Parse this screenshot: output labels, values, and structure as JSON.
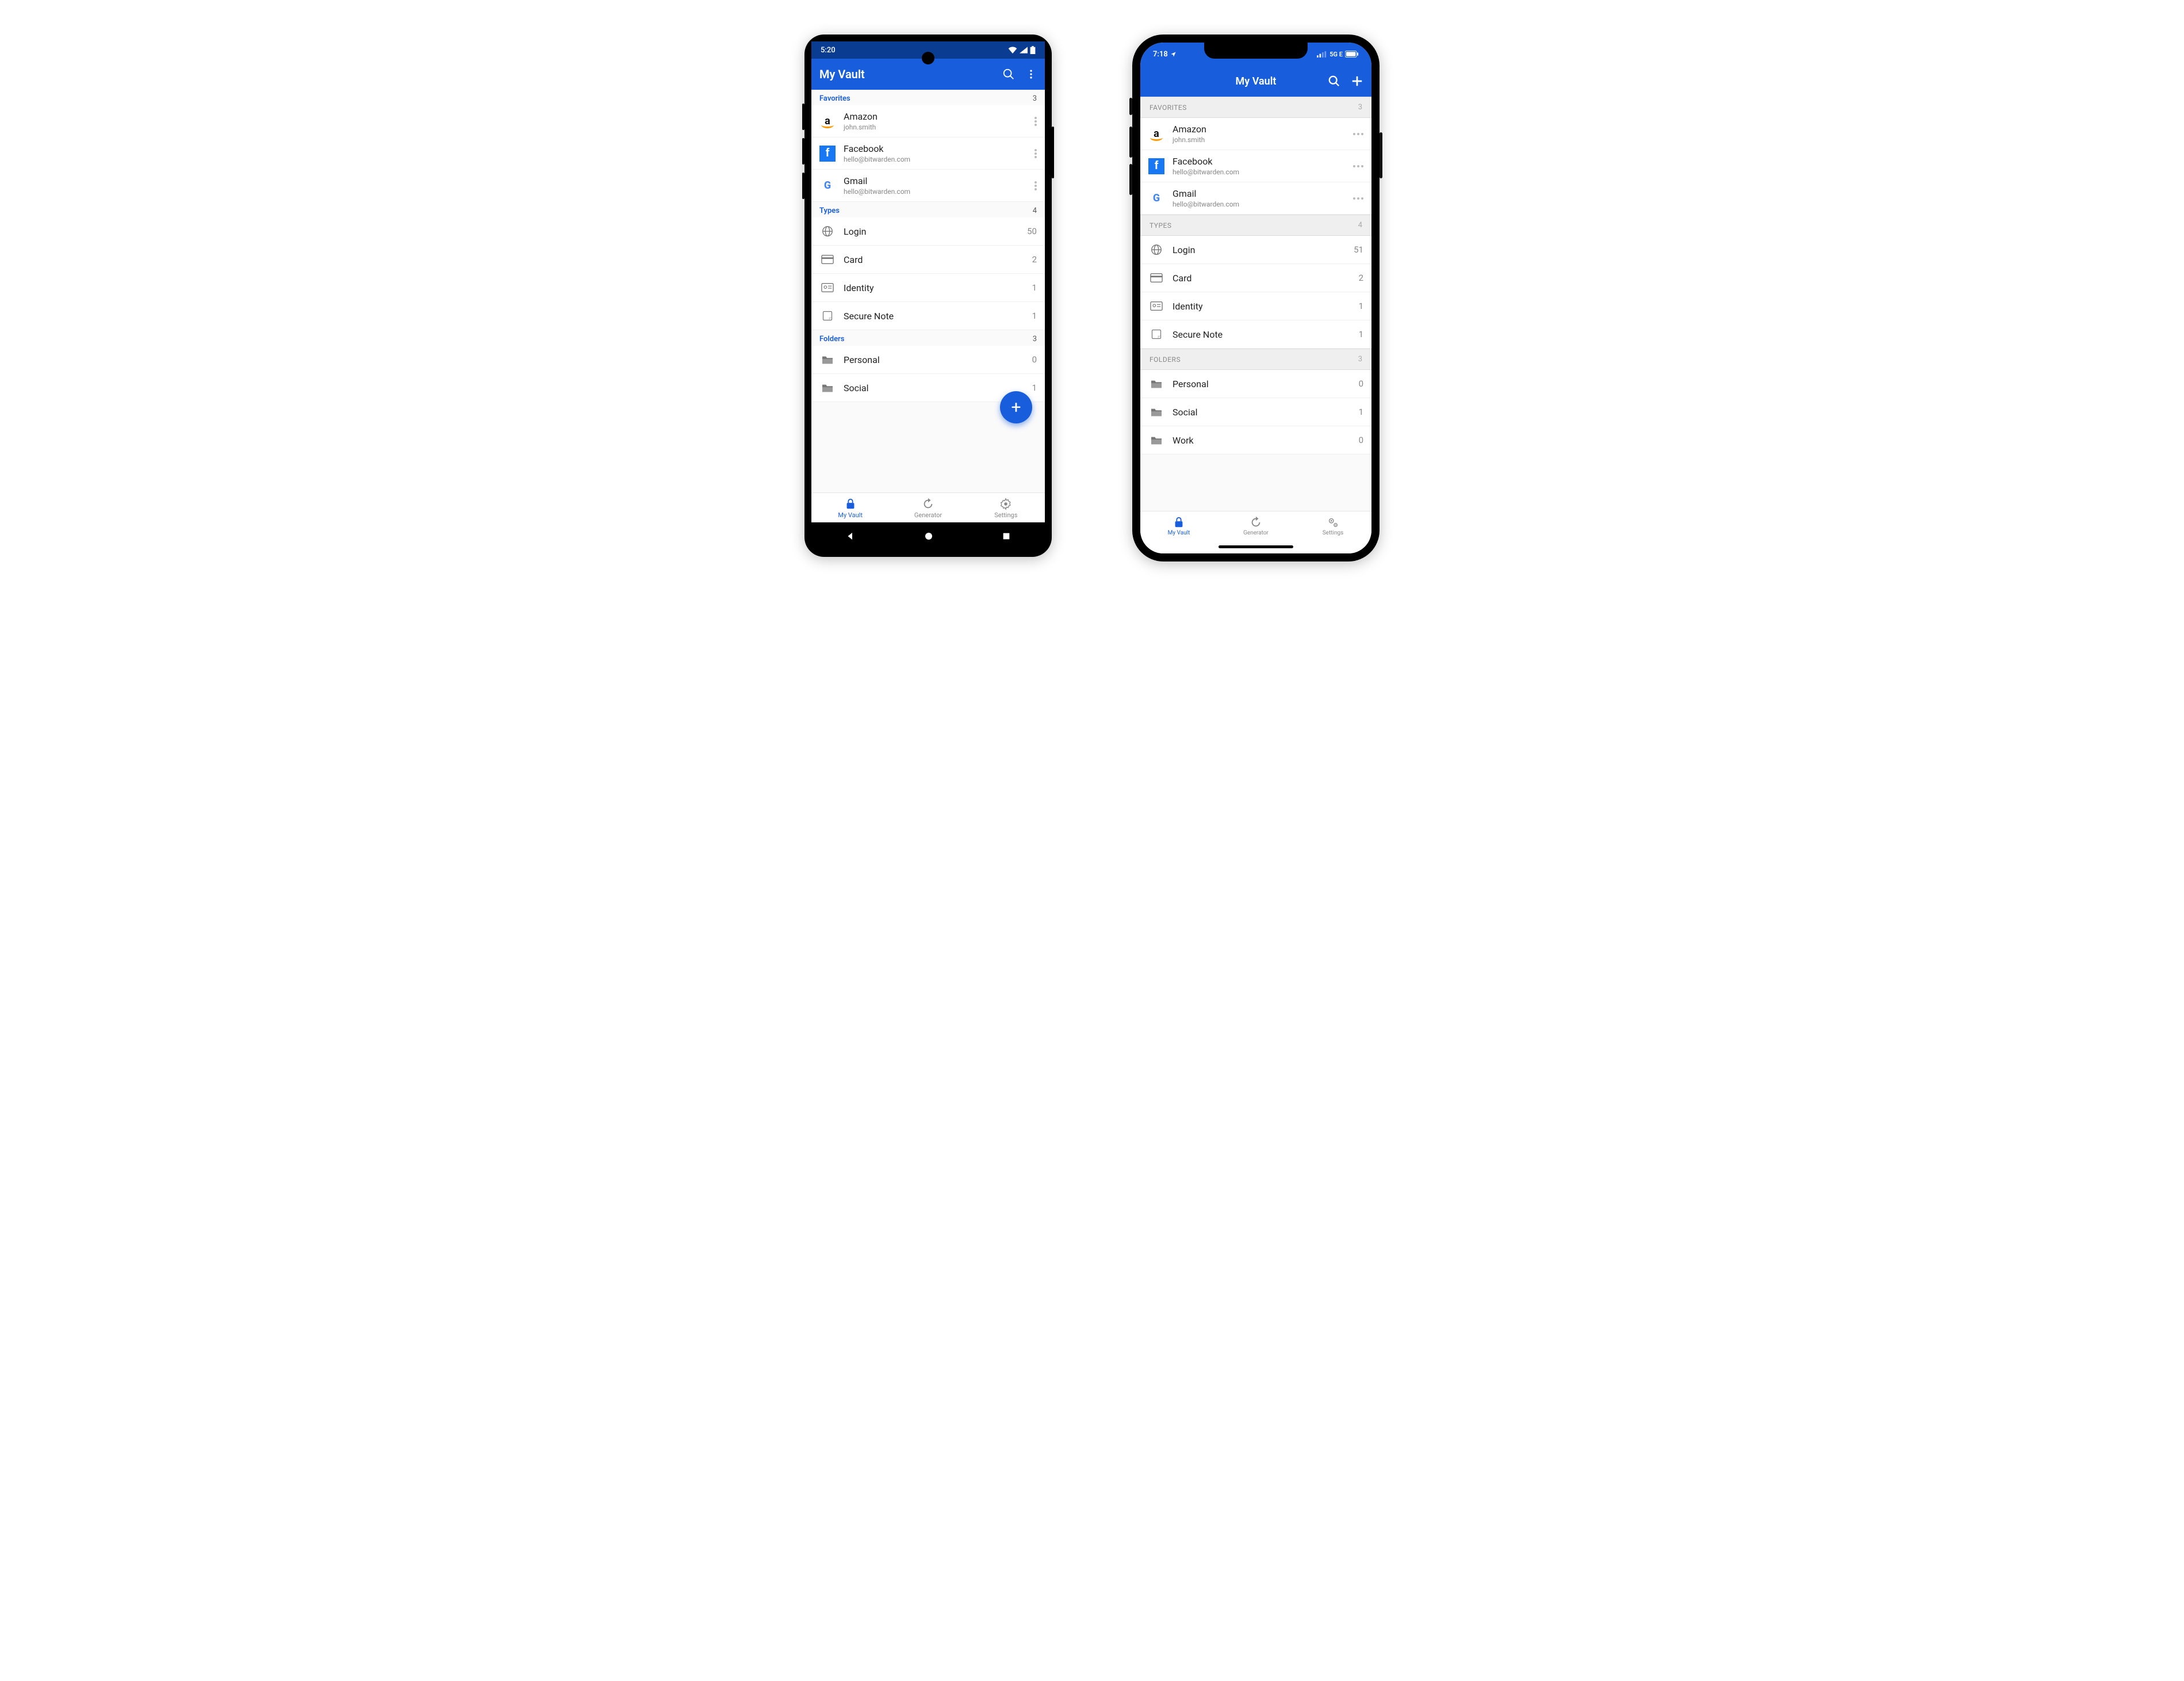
{
  "colors": {
    "primary": "#175ddc",
    "primary_dark": "#0a3d91"
  },
  "android": {
    "status": {
      "time": "5:20"
    },
    "header": {
      "title": "My Vault"
    },
    "sections": {
      "favorites": {
        "label": "Favorites",
        "count": "3",
        "items": [
          {
            "title": "Amazon",
            "sub": "john.smith",
            "brand": "amazon"
          },
          {
            "title": "Facebook",
            "sub": "hello@bitwarden.com",
            "brand": "facebook"
          },
          {
            "title": "Gmail",
            "sub": "hello@bitwarden.com",
            "brand": "gmail"
          }
        ]
      },
      "types": {
        "label": "Types",
        "count": "4",
        "items": [
          {
            "title": "Login",
            "count": "50",
            "icon": "globe"
          },
          {
            "title": "Card",
            "count": "2",
            "icon": "card"
          },
          {
            "title": "Identity",
            "count": "1",
            "icon": "identity"
          },
          {
            "title": "Secure Note",
            "count": "1",
            "icon": "note"
          }
        ]
      },
      "folders": {
        "label": "Folders",
        "count": "3",
        "items": [
          {
            "title": "Personal",
            "count": "0",
            "icon": "folder"
          },
          {
            "title": "Social",
            "count": "1",
            "icon": "folder"
          }
        ]
      }
    },
    "fab": {
      "label": "+"
    },
    "nav": {
      "items": [
        {
          "label": "My Vault",
          "active": true
        },
        {
          "label": "Generator",
          "active": false
        },
        {
          "label": "Settings",
          "active": false
        }
      ]
    }
  },
  "ios": {
    "status": {
      "time": "7:18",
      "network": "5G E"
    },
    "header": {
      "title": "My Vault"
    },
    "sections": {
      "favorites": {
        "label": "FAVORITES",
        "count": "3",
        "items": [
          {
            "title": "Amazon",
            "sub": "john.smith",
            "brand": "amazon"
          },
          {
            "title": "Facebook",
            "sub": "hello@bitwarden.com",
            "brand": "facebook"
          },
          {
            "title": "Gmail",
            "sub": "hello@bitwarden.com",
            "brand": "gmail"
          }
        ]
      },
      "types": {
        "label": "TYPES",
        "count": "4",
        "items": [
          {
            "title": "Login",
            "count": "51",
            "icon": "globe"
          },
          {
            "title": "Card",
            "count": "2",
            "icon": "card"
          },
          {
            "title": "Identity",
            "count": "1",
            "icon": "identity"
          },
          {
            "title": "Secure Note",
            "count": "1",
            "icon": "note"
          }
        ]
      },
      "folders": {
        "label": "FOLDERS",
        "count": "3",
        "items": [
          {
            "title": "Personal",
            "count": "0",
            "icon": "folder"
          },
          {
            "title": "Social",
            "count": "1",
            "icon": "folder"
          },
          {
            "title": "Work",
            "count": "0",
            "icon": "folder"
          }
        ]
      }
    },
    "nav": {
      "items": [
        {
          "label": "My Vault",
          "active": true
        },
        {
          "label": "Generator",
          "active": false
        },
        {
          "label": "Settings",
          "active": false
        }
      ]
    }
  }
}
